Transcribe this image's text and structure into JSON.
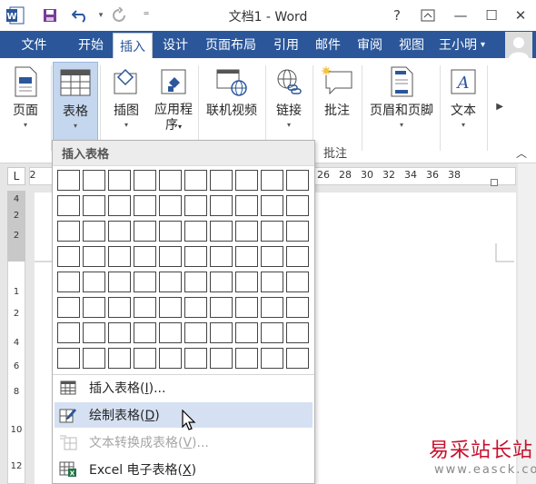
{
  "window": {
    "title": "文档1 - Word",
    "help": "?",
    "restore_ribbon": "⊡",
    "minimize": "—",
    "maximize": "☐",
    "close": "✕",
    "quick_access_more": "⁼"
  },
  "tabs": {
    "file": "文件",
    "items": [
      "开始",
      "插入",
      "设计",
      "页面布局",
      "引用",
      "邮件",
      "审阅",
      "视图"
    ],
    "active_index": 1,
    "user": "王小明",
    "user_caret": "▾"
  },
  "ribbon": {
    "buttons": {
      "page": "页面",
      "table": "表格",
      "illustrations": "插图",
      "apps_line1": "应用程",
      "apps_line2": "序",
      "online_video": "联机视频",
      "links": "链接",
      "comment": "批注",
      "header_footer": "页眉和页脚",
      "text": "文本"
    },
    "groups": {
      "comments": "批注"
    },
    "caret": "▾",
    "scroll_right": "▶",
    "collapse": "︿"
  },
  "ruler": {
    "tab_selector": "L",
    "h_ticks": [
      "2",
      "26",
      "28",
      "30",
      "32",
      "34",
      "36",
      "38"
    ],
    "v_ticks": [
      "4",
      "2",
      "2",
      "1",
      "2",
      "4",
      "6",
      "8",
      "10",
      "12"
    ]
  },
  "dropdown": {
    "header": "插入表格",
    "grid_cols": 10,
    "grid_rows": 8,
    "items": {
      "insert_table": {
        "text": "插入表格(",
        "key": "I",
        "suffix": ")..."
      },
      "draw_table": {
        "text": "绘制表格(",
        "key": "D",
        "suffix": ")"
      },
      "text_to_table": {
        "text": "文本转换成表格(",
        "key": "V",
        "suffix": ")..."
      },
      "excel_table": {
        "text": "Excel 电子表格(",
        "key": "X",
        "suffix": ")"
      }
    },
    "hovered_item": "draw_table",
    "disabled_item": "text_to_table"
  },
  "watermark": {
    "line1": "易采站长站",
    "line2": "www.easck.com"
  },
  "colors": {
    "word_blue": "#2b579a",
    "selected_button": "#c5d7ee",
    "hover_item": "#d5e1f2",
    "watermark_red": "#c8102e"
  }
}
